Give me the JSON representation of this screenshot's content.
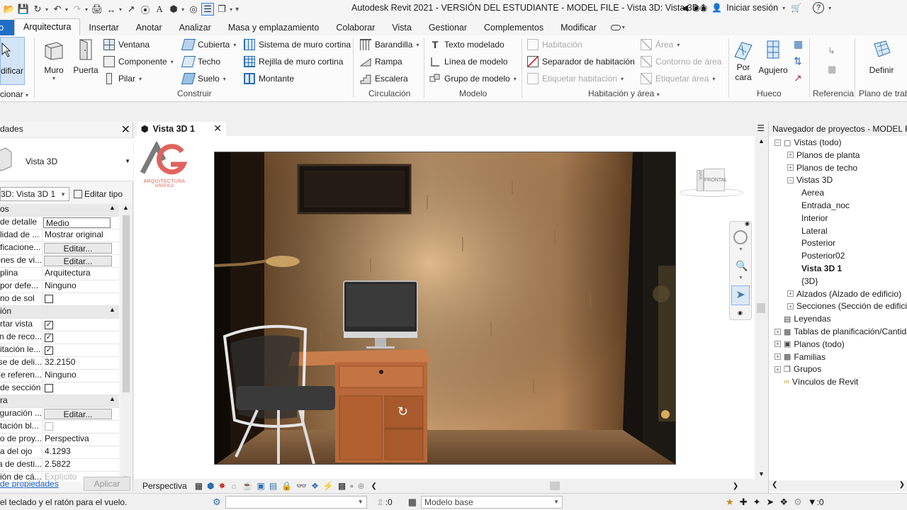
{
  "window": {
    "title": "Autodesk Revit 2021 - VERSIÓN DEL ESTUDIANTE - MODEL FILE - Vista 3D: Vista 3D 1",
    "signin": "Iniciar sesión"
  },
  "ribbon_tabs": [
    {
      "label": "vo"
    },
    {
      "label": "Arquitectura"
    },
    {
      "label": "Insertar"
    },
    {
      "label": "Anotar"
    },
    {
      "label": "Analizar"
    },
    {
      "label": "Masa y emplazamiento"
    },
    {
      "label": "Colaborar"
    },
    {
      "label": "Vista"
    },
    {
      "label": "Gestionar"
    },
    {
      "label": "Complementos"
    },
    {
      "label": "Modificar"
    }
  ],
  "ribbon": {
    "modificar": "dificar",
    "seleccionar": "cionar",
    "muro": "Muro",
    "puerta": "Puerta",
    "ventana": "Ventana",
    "componente": "Componente",
    "pilar": "Pilar",
    "cubierta": "Cubierta",
    "techo": "Techo",
    "suelo": "Suelo",
    "sistema_muro_cortina": "Sistema de muro cortina",
    "rejilla_muro_cortina": "Rejilla de muro cortina",
    "montante": "Montante",
    "construir": "Construir",
    "barandilla": "Barandilla",
    "rampa": "Rampa",
    "escalera": "Escalera",
    "circulacion": "Circulación",
    "texto_modelado": "Texto modelado",
    "linea_modelo": "Línea de modelo",
    "grupo_modelo": "Grupo de modelo",
    "modelo": "Modelo",
    "habitacion": "Habitación",
    "separador_habitacion": "Separador de habitación",
    "etiquetar_habitacion": "Etiquetar habitación",
    "area": "Área",
    "contorno_area": "Contorno de área",
    "etiquetar_area": "Etiquetar área",
    "habitacion_area": "Habitación y área",
    "por_cara_1": "Por",
    "por_cara_2": "cara",
    "agujero": "Agujero",
    "hueco": "Hueco",
    "referencia": "Referencia",
    "definir": "Definir",
    "plano_trabajo": "Plano de trab"
  },
  "properties": {
    "title": "dades",
    "type_name": "Vista 3D",
    "instance": "3D: Vista 3D 1",
    "edit_type": "Editar tipo",
    "rows": [
      {
        "kind": "section",
        "name": "os"
      },
      {
        "kind": "row",
        "name": "de detalle",
        "value": "Medio",
        "style": "boxed"
      },
      {
        "kind": "row",
        "name": "lidad de ...",
        "value": "Mostrar original"
      },
      {
        "kind": "row",
        "name": "ficacione...",
        "value": "Editar...",
        "style": "edit"
      },
      {
        "kind": "row",
        "name": "ones de vi...",
        "value": "Editar...",
        "style": "edit"
      },
      {
        "kind": "row",
        "name": "plina",
        "value": "Arquitectura"
      },
      {
        "kind": "row",
        "name": "por defe...",
        "value": "Ninguno"
      },
      {
        "kind": "check",
        "name": "no de sol",
        "checked": false
      },
      {
        "kind": "section",
        "name": "ión"
      },
      {
        "kind": "check",
        "name": "rtar vista",
        "checked": true
      },
      {
        "kind": "check",
        "name": "on de reco...",
        "checked": true
      },
      {
        "kind": "check",
        "name": "itación le...",
        "checked": true
      },
      {
        "kind": "row",
        "name": "se de deli...",
        "value": "32.2150"
      },
      {
        "kind": "row",
        "name": "de referen...",
        "value": "Ninguno"
      },
      {
        "kind": "check",
        "name": "de sección",
        "checked": false
      },
      {
        "kind": "section",
        "name": "ra"
      },
      {
        "kind": "row",
        "name": "guración ...",
        "value": "Editar...",
        "style": "edit"
      },
      {
        "kind": "check",
        "name": "tación bl...",
        "checked": false,
        "dim": true
      },
      {
        "kind": "row",
        "name": "o de proy...",
        "value": "Perspectiva"
      },
      {
        "kind": "row",
        "name": "a del ojo",
        "value": "4.1293"
      },
      {
        "kind": "row",
        "name": "a de desti...",
        "value": "2.5822"
      },
      {
        "kind": "row",
        "name": "ión de cá...",
        "value": "Explícito",
        "style": "dim"
      }
    ],
    "help_link": "de propiedades",
    "apply": "Aplicar"
  },
  "view": {
    "tab_label": "Vista 3D 1",
    "mode": "Perspectiva",
    "logo_text_1": "ARQUITECTURA",
    "logo_text_2": "GRÁFICA",
    "viewcube_label": "FRONTAL",
    "viewcube_side": "ARR"
  },
  "browser": {
    "title": "Navegador de proyectos - MODEL FILE",
    "nodes": [
      {
        "label": "Vistas (todo)",
        "level": 0,
        "exp": "-"
      },
      {
        "label": "Planos de planta",
        "level": 1,
        "exp": "+"
      },
      {
        "label": "Planos de techo",
        "level": 1,
        "exp": "+"
      },
      {
        "label": "Vistas 3D",
        "level": 1,
        "exp": "-"
      },
      {
        "label": "Aerea",
        "level": 2
      },
      {
        "label": "Entrada_noc",
        "level": 2
      },
      {
        "label": "Interior",
        "level": 2
      },
      {
        "label": "Lateral",
        "level": 2
      },
      {
        "label": "Posterior",
        "level": 2
      },
      {
        "label": "Posterior02",
        "level": 2
      },
      {
        "label": "Vista 3D 1",
        "level": 2,
        "selected": true
      },
      {
        "label": "{3D}",
        "level": 2
      },
      {
        "label": "Alzados (Alzado de edificio)",
        "level": 1,
        "exp": "+"
      },
      {
        "label": "Secciones (Sección de edificio)",
        "level": 1,
        "exp": "+"
      },
      {
        "label": "Leyendas",
        "level": 0,
        "exp": ""
      },
      {
        "label": "Tablas de planificación/Cantidades",
        "level": 0,
        "exp": "+"
      },
      {
        "label": "Planos (todo)",
        "level": 0,
        "exp": "+"
      },
      {
        "label": "Familias",
        "level": 0,
        "exp": "+"
      },
      {
        "label": "Grupos",
        "level": 0,
        "exp": "+"
      },
      {
        "label": "Vínculos de Revit",
        "level": 0,
        "exp": ""
      }
    ]
  },
  "status": {
    "message": "el teclado y el ratón para el vuelo.",
    "count_1": ":0",
    "model": "Modelo base",
    "count_2": ":0"
  }
}
